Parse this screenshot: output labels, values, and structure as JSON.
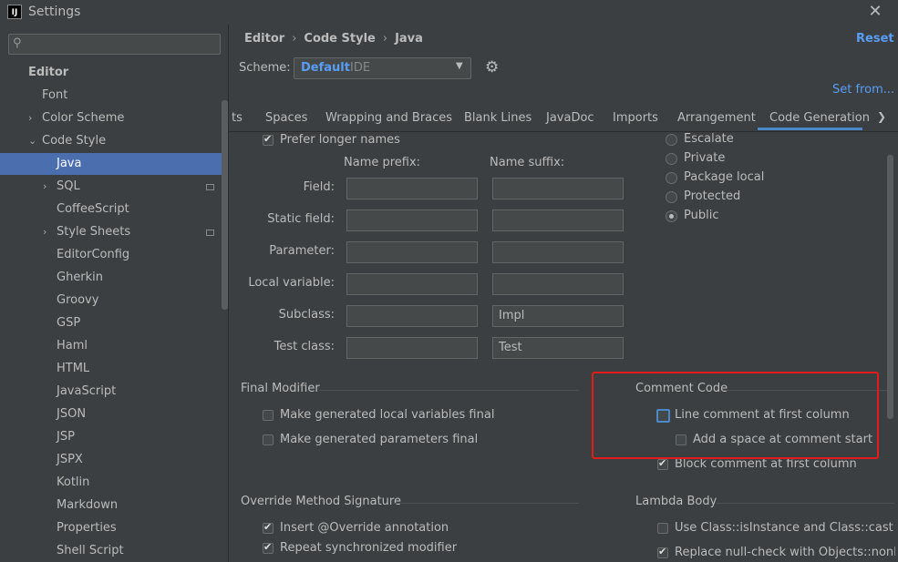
{
  "window": {
    "title": "Settings",
    "app_icon": "IJ"
  },
  "sidebar": {
    "search_placeholder": "",
    "items": [
      {
        "label": "Editor",
        "level": 0,
        "expand": "",
        "bold": true
      },
      {
        "label": "Font",
        "level": 1,
        "expand": ""
      },
      {
        "label": "Color Scheme",
        "level": 1,
        "expand": "collapsed"
      },
      {
        "label": "Code Style",
        "level": 1,
        "expand": "expanded"
      },
      {
        "label": "Java",
        "level": 2,
        "expand": "",
        "selected": true
      },
      {
        "label": "SQL",
        "level": 2,
        "expand": "collapsed",
        "mark": true
      },
      {
        "label": "CoffeeScript",
        "level": 2,
        "expand": ""
      },
      {
        "label": "Style Sheets",
        "level": 2,
        "expand": "collapsed",
        "mark": true
      },
      {
        "label": "EditorConfig",
        "level": 2,
        "expand": ""
      },
      {
        "label": "Gherkin",
        "level": 2,
        "expand": ""
      },
      {
        "label": "Groovy",
        "level": 2,
        "expand": ""
      },
      {
        "label": "GSP",
        "level": 2,
        "expand": ""
      },
      {
        "label": "Haml",
        "level": 2,
        "expand": ""
      },
      {
        "label": "HTML",
        "level": 2,
        "expand": ""
      },
      {
        "label": "JavaScript",
        "level": 2,
        "expand": ""
      },
      {
        "label": "JSON",
        "level": 2,
        "expand": ""
      },
      {
        "label": "JSP",
        "level": 2,
        "expand": ""
      },
      {
        "label": "JSPX",
        "level": 2,
        "expand": ""
      },
      {
        "label": "Kotlin",
        "level": 2,
        "expand": ""
      },
      {
        "label": "Markdown",
        "level": 2,
        "expand": ""
      },
      {
        "label": "Properties",
        "level": 2,
        "expand": ""
      },
      {
        "label": "Shell Script",
        "level": 2,
        "expand": ""
      }
    ]
  },
  "header": {
    "breadcrumb": [
      "Editor",
      "Code Style",
      "Java"
    ],
    "reset": "Reset",
    "scheme_label": "Scheme:",
    "scheme_name": "Default",
    "scheme_type": "IDE",
    "set_from": "Set from..."
  },
  "tabs": [
    "ts",
    "Spaces",
    "Wrapping and Braces",
    "Blank Lines",
    "JavaDoc",
    "Imports",
    "Arrangement",
    "Code Generation"
  ],
  "active_tab": "Code Generation",
  "naming": {
    "prefer_longer": "Prefer longer names",
    "prefix_header": "Name prefix:",
    "suffix_header": "Name suffix:",
    "rows": [
      {
        "label": "Field:",
        "prefix": "",
        "suffix": ""
      },
      {
        "label": "Static field:",
        "prefix": "",
        "suffix": ""
      },
      {
        "label": "Parameter:",
        "prefix": "",
        "suffix": ""
      },
      {
        "label": "Local variable:",
        "prefix": "",
        "suffix": ""
      },
      {
        "label": "Subclass:",
        "prefix": "",
        "suffix": "Impl"
      },
      {
        "label": "Test class:",
        "prefix": "",
        "suffix": "Test"
      }
    ]
  },
  "visibility": {
    "options": [
      "Escalate",
      "Private",
      "Package local",
      "Protected",
      "Public"
    ],
    "selected": "Public"
  },
  "final_modifier": {
    "title": "Final Modifier",
    "local_vars": "Make generated local variables final",
    "params": "Make generated parameters final"
  },
  "comment_code": {
    "title": "Comment Code",
    "line_first_col": "Line comment at first column",
    "add_space": "Add a space at comment start",
    "block_first_col": "Block comment at first column"
  },
  "override": {
    "title": "Override Method Signature",
    "insert_override": "Insert @Override annotation",
    "repeat_sync": "Repeat synchronized modifier"
  },
  "lambda": {
    "title": "Lambda Body",
    "use_class": "Use Class::isInstance and Class::cast when",
    "replace_null": "Replace null-check with Objects::nonNull o"
  },
  "colors": {
    "accent": "#589df6",
    "selection": "#4b6eaf",
    "highlight_box": "#e31b1b"
  }
}
